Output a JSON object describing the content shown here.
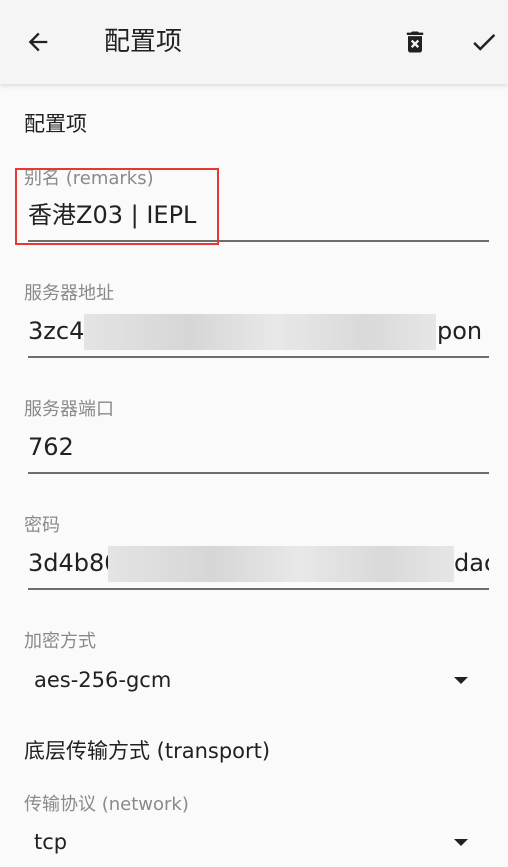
{
  "appbar": {
    "title": "配置项",
    "icons": {
      "back": "arrow-back-icon",
      "delete": "delete-icon",
      "confirm": "check-icon"
    }
  },
  "section_main": "配置项",
  "remarks": {
    "label": "别名 (remarks)",
    "value": "香港Z03 | IEPL"
  },
  "server_address": {
    "label": "服务器地址",
    "value_prefix": "3zc4",
    "value_suffix": "pon"
  },
  "server_port": {
    "label": "服务器端口",
    "value": "762"
  },
  "password": {
    "label": "密码",
    "value_prefix": "3d4b80",
    "value_suffix": "dac"
  },
  "encryption": {
    "label": "加密方式",
    "value": "aes-256-gcm"
  },
  "section_transport": "底层传输方式 (transport)",
  "network": {
    "label": "传输协议 (network)",
    "value": "tcp"
  },
  "colors": {
    "highlight": "#e53935",
    "label": "#8a8a8a",
    "underline": "#6e6e6e"
  }
}
